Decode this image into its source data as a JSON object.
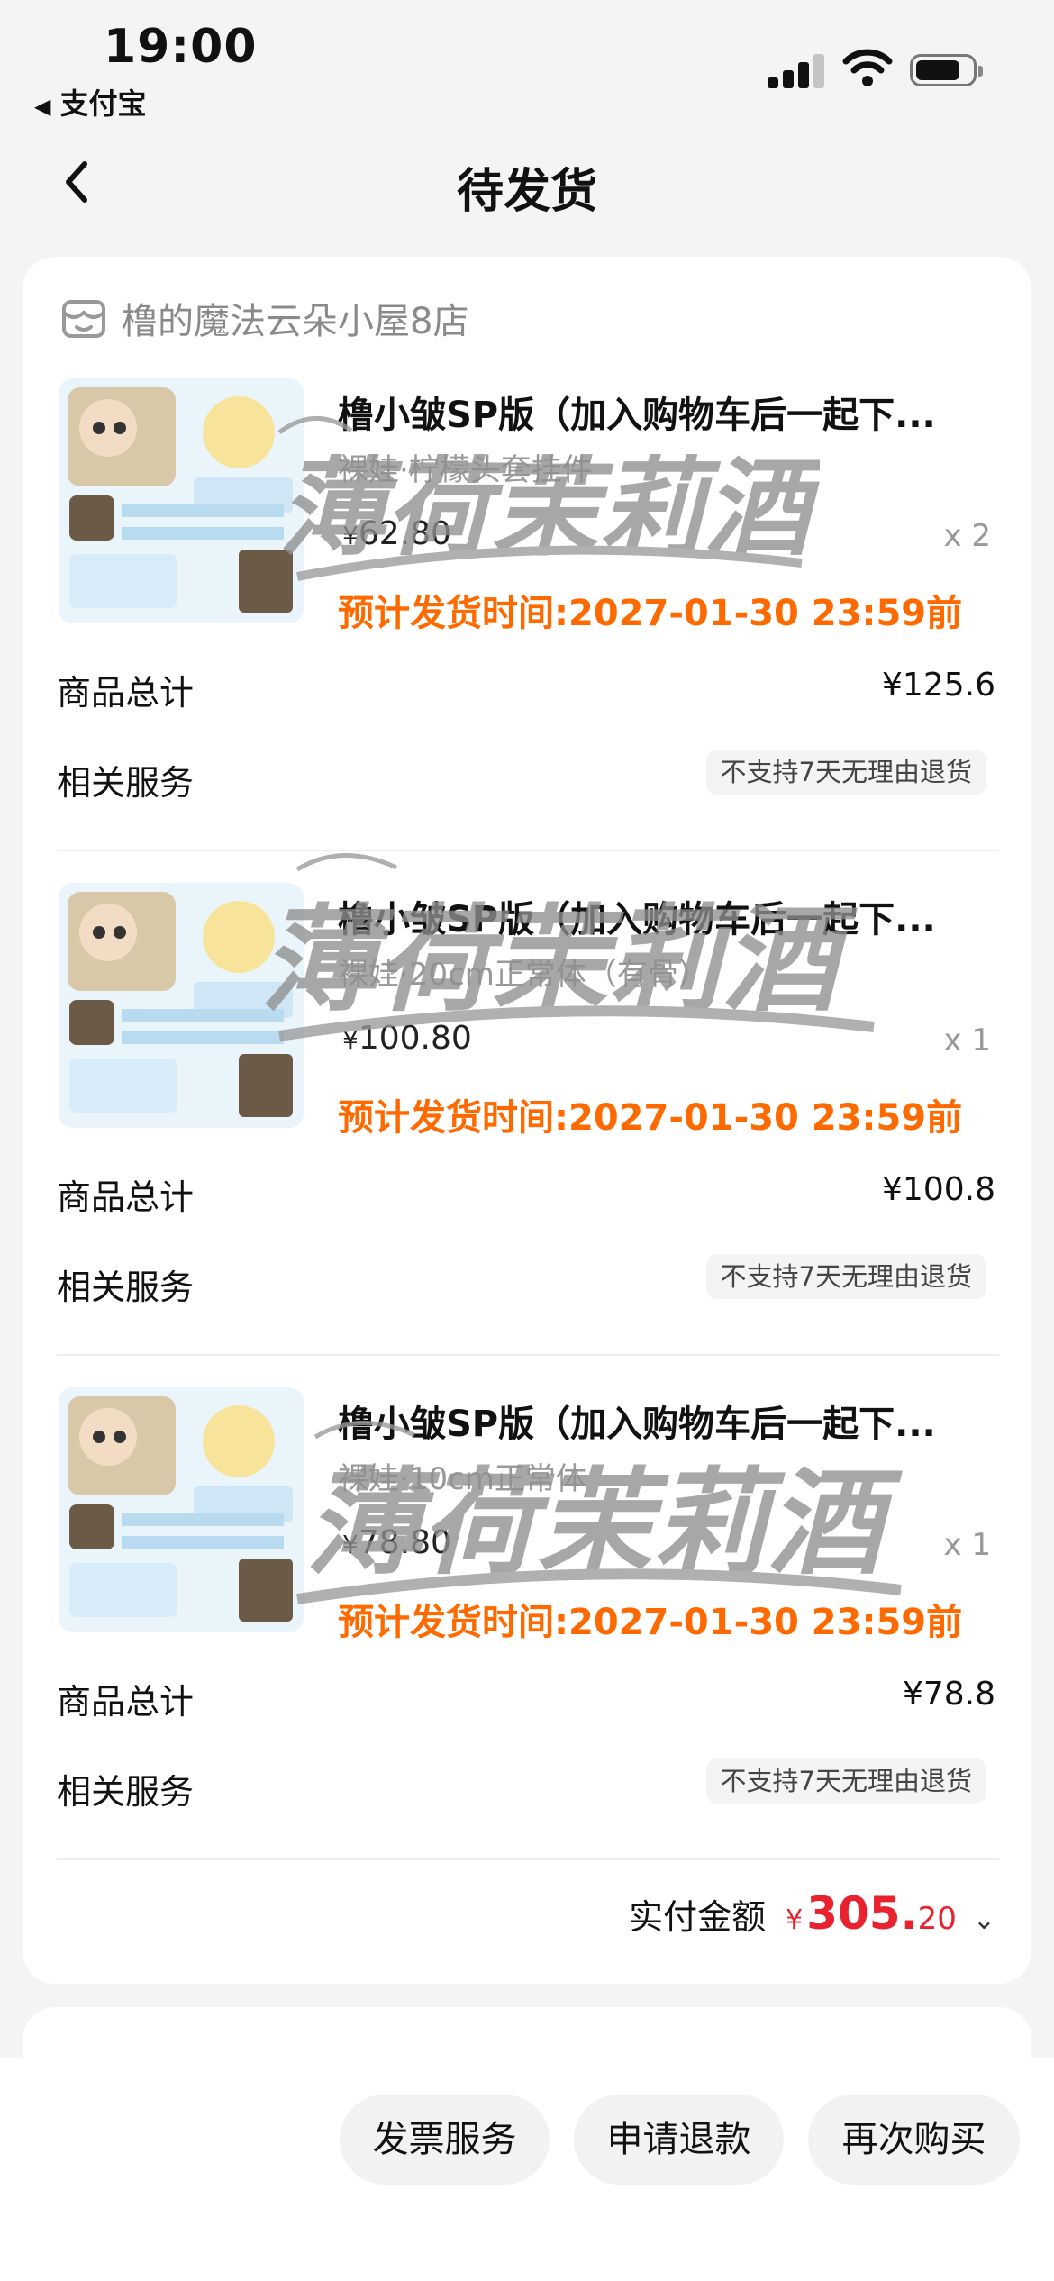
{
  "status_bar": {
    "time": "19:00",
    "back_app": "支付宝"
  },
  "header": {
    "title": "待发货"
  },
  "shop": {
    "name": "橹的魔法云朵小屋8店"
  },
  "items": [
    {
      "title": "橹小皱SP版（加入购物车后一起下...",
      "sku": "裸娃·柠檬头套挂件",
      "price_symbol": "¥",
      "price": "62.80",
      "qty": "x 2",
      "ship_time": "预计发货时间:2027-01-30 23:59前",
      "subtotal_label": "商品总计",
      "subtotal": "¥125.6",
      "service_label": "相关服务",
      "service_tag": "不支持7天无理由退货"
    },
    {
      "title": "橹小皱SP版（加入购物车后一起下...",
      "sku": "裸娃·20cm正常体（有骨）",
      "price_symbol": "¥",
      "price": "100.80",
      "qty": "x 1",
      "ship_time": "预计发货时间:2027-01-30 23:59前",
      "subtotal_label": "商品总计",
      "subtotal": "¥100.8",
      "service_label": "相关服务",
      "service_tag": "不支持7天无理由退货"
    },
    {
      "title": "橹小皱SP版（加入购物车后一起下...",
      "sku": "裸娃·10cm正常体",
      "price_symbol": "¥",
      "price": "78.80",
      "qty": "x 1",
      "ship_time": "预计发货时间:2027-01-30 23:59前",
      "subtotal_label": "商品总计",
      "subtotal": "¥78.8",
      "service_label": "相关服务",
      "service_tag": "不支持7天无理由退货"
    }
  ],
  "total": {
    "label": "实付金额",
    "symbol": "¥",
    "integer": "305.",
    "decimal": "20"
  },
  "watermark": {
    "text": "薄荷茉莉酒"
  },
  "actions": {
    "invoice": "发票服务",
    "refund": "申请退款",
    "rebuy": "再次购买"
  },
  "colors": {
    "accent_orange": "#ff6a00",
    "price_red": "#e8232f",
    "background": "#f4f4f4"
  }
}
